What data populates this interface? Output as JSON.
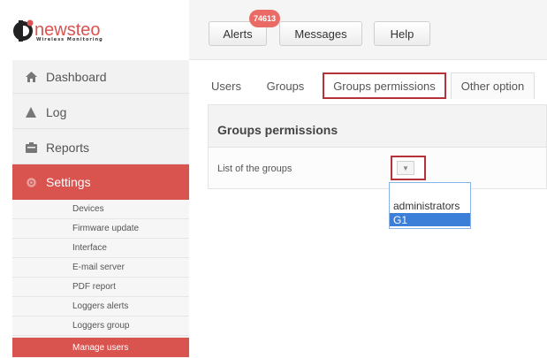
{
  "logo": {
    "text": "newsteo",
    "tagline": "Wireless Monitoring",
    "initial": "D"
  },
  "topbar": {
    "alerts_label": "Alerts",
    "alerts_count": "74613",
    "messages_label": "Messages",
    "help_label": "Help"
  },
  "sidebar": {
    "items": [
      {
        "label": "Dashboard",
        "icon": "home-icon"
      },
      {
        "label": "Log",
        "icon": "log-icon"
      },
      {
        "label": "Reports",
        "icon": "reports-icon"
      },
      {
        "label": "Settings",
        "icon": "settings-icon",
        "active": true
      }
    ],
    "sub_items": [
      "Devices",
      "Firmware update",
      "Interface",
      "E-mail server",
      "PDF report",
      "Loggers alerts",
      "Loggers group",
      "Manage users"
    ],
    "active_sub_item": "Manage users"
  },
  "tabs": [
    {
      "label": "Users"
    },
    {
      "label": "Groups"
    },
    {
      "label": "Groups permissions",
      "active": true
    },
    {
      "label": "Other option"
    }
  ],
  "panel": {
    "title": "Groups permissions",
    "field_label": "List of the groups",
    "dropdown_options": [
      "administrators",
      "G1"
    ],
    "selected_option": "G1"
  },
  "colors": {
    "accent_red": "#d9534f",
    "highlight_border": "#b5323a",
    "badge": "#ea6b66",
    "selection_blue": "#3b7fd9"
  }
}
